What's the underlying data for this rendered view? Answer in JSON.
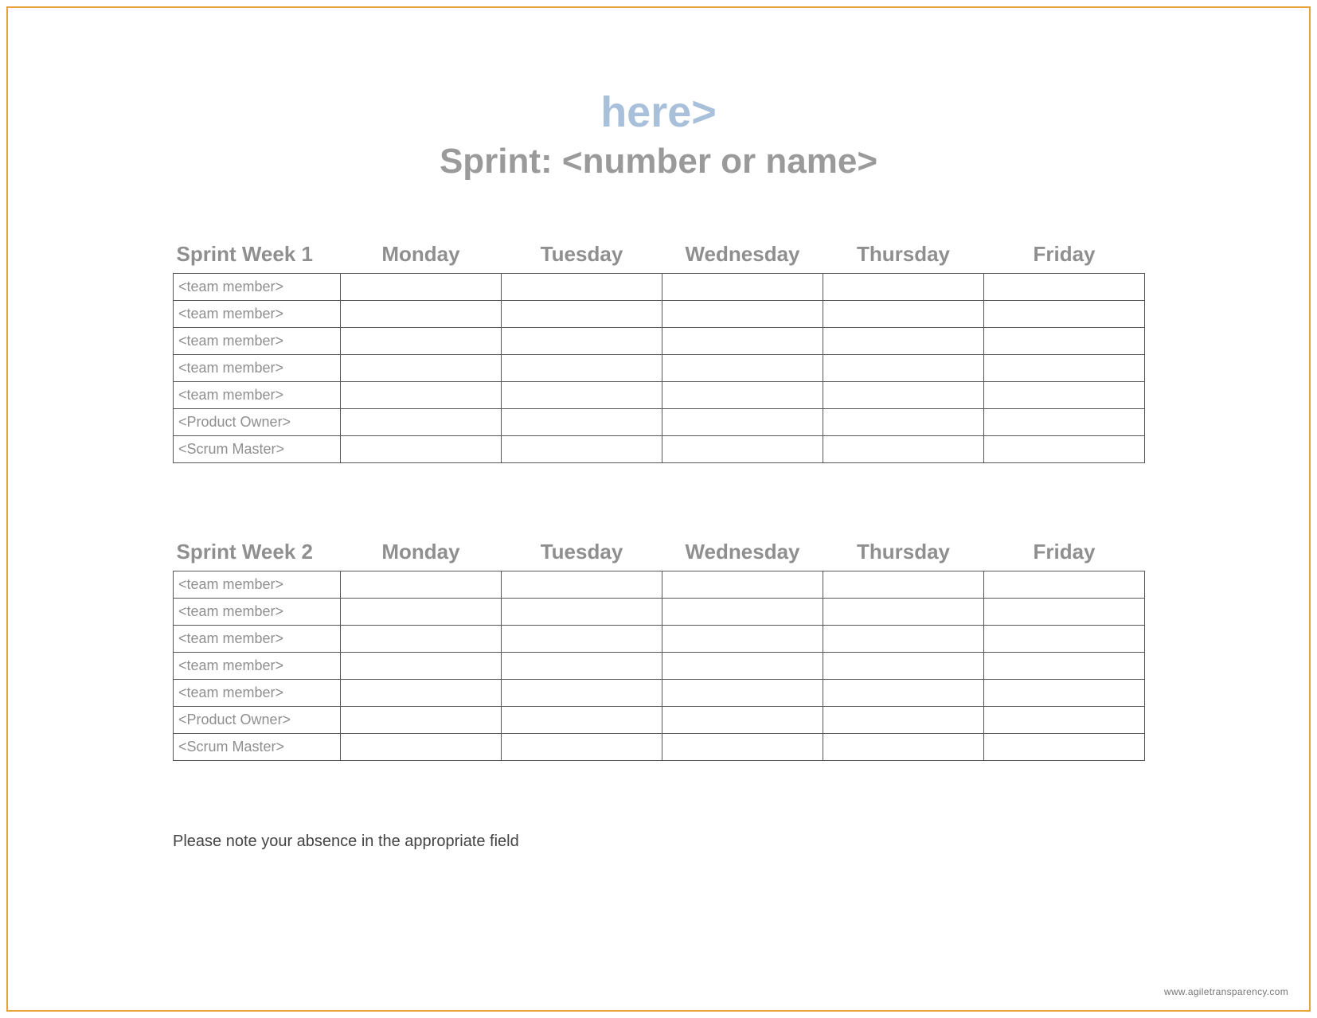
{
  "header": {
    "line1": "here>",
    "line2": "Sprint: <number or name>"
  },
  "days": [
    "Monday",
    "Tuesday",
    "Wednesday",
    "Thursday",
    "Friday"
  ],
  "weeks": [
    {
      "title": "Sprint Week 1",
      "roles": [
        "<team member>",
        "<team member>",
        "<team member>",
        "<team member>",
        "<team member>",
        "<Product Owner>",
        "<Scrum Master>"
      ]
    },
    {
      "title": "Sprint Week 2",
      "roles": [
        "<team member>",
        "<team member>",
        "<team member>",
        "<team member>",
        "<team member>",
        "<Product Owner>",
        "<Scrum Master>"
      ]
    }
  ],
  "footer_note": "Please note your absence in the appropriate field",
  "watermark": "www.agiletransparency.com"
}
